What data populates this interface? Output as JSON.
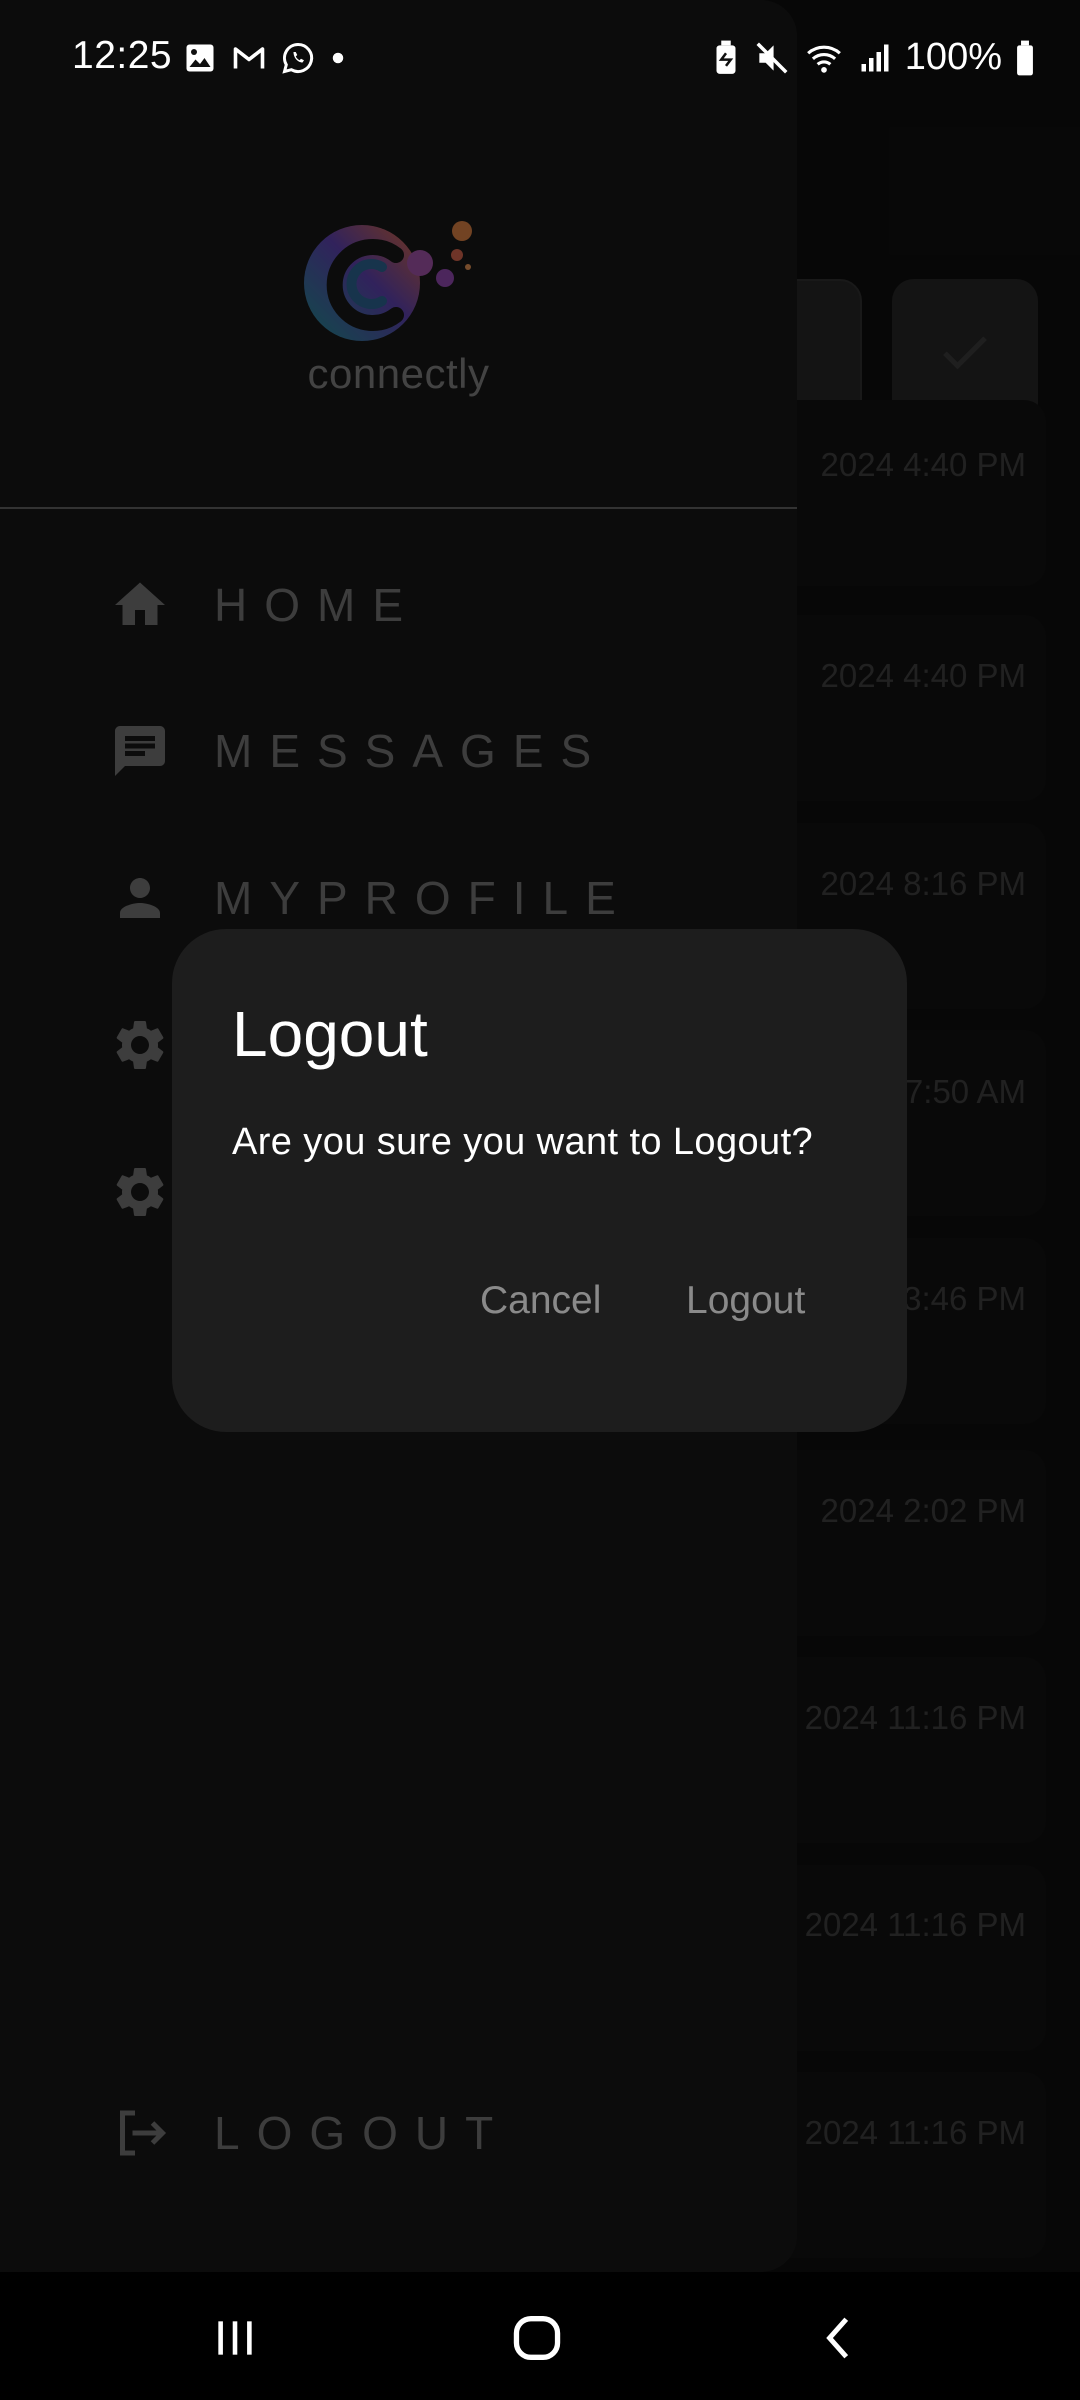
{
  "status_bar": {
    "time": "12:25",
    "battery": "100%",
    "left_icons": [
      "gallery-icon",
      "gmail-icon",
      "whatsapp-icon",
      "notification-dot-icon"
    ],
    "right_icons": [
      "battery-saver-icon",
      "mute-icon",
      "wifi-icon",
      "signal-icon",
      "battery-icon"
    ]
  },
  "background": {
    "timestamps": [
      "2024 4:40 PM",
      "2024 4:40 PM",
      "2024 8:16 PM",
      "7:50 AM",
      "3:46 PM",
      "2024 2:02 PM",
      "2024 11:16 PM",
      "2024 11:16 PM",
      "2024 11:16 PM"
    ]
  },
  "drawer": {
    "logo_text": "connectly",
    "items": [
      {
        "label": "HOME",
        "icon": "home-icon"
      },
      {
        "label": "MESSAGES",
        "icon": "message-icon"
      },
      {
        "label": "MYPROFILE",
        "icon": "person-icon"
      },
      {
        "label": "",
        "icon": "gear-icon"
      },
      {
        "label": "",
        "icon": "gear-icon"
      }
    ],
    "logout_label": "LOGOUT"
  },
  "dialog": {
    "title": "Logout",
    "message": "Are you sure you want to Logout?",
    "cancel_label": "Cancel",
    "confirm_label": "Logout"
  },
  "colors": {
    "drawer_bg": "#161616",
    "dialog_bg": "#1d1d1d",
    "muted_text": "#6f6f6f",
    "logo_gradient": [
      "#1f8a8a",
      "#5a3fa8",
      "#d2643a"
    ]
  }
}
